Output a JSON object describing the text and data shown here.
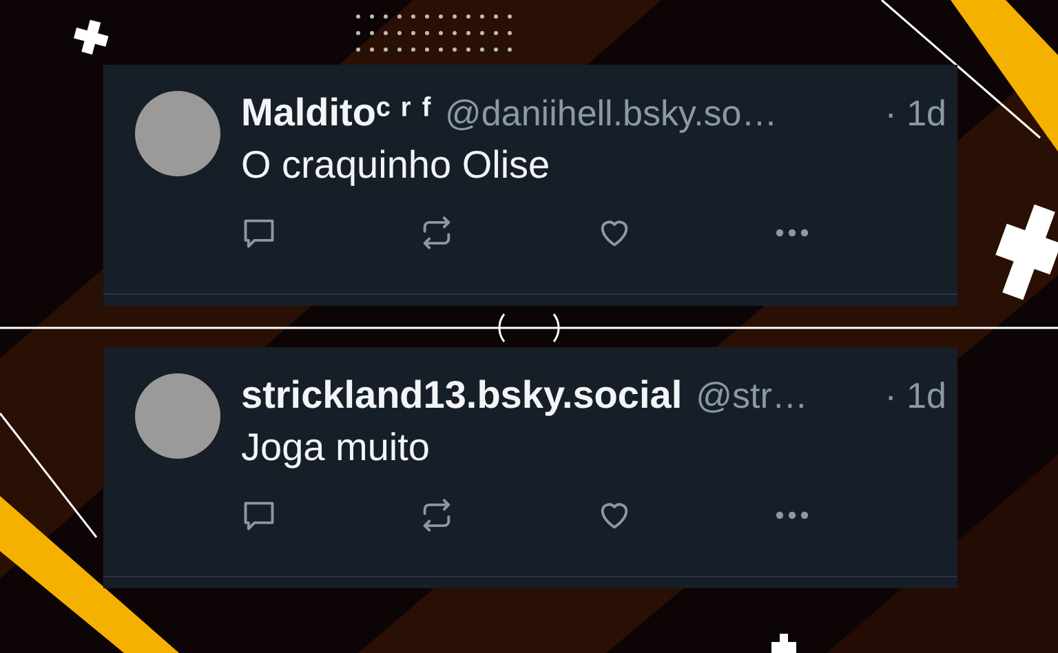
{
  "posts": [
    {
      "display_name": "Malditoᶜ ʳ ᶠ",
      "handle": "@daniihell.bsky.so…",
      "time": "· 1d",
      "text": "O craquinho Olise"
    },
    {
      "display_name": "strickland13.bsky.social",
      "handle": "@str…",
      "time": "· 1d",
      "text": "Joga muito"
    }
  ]
}
